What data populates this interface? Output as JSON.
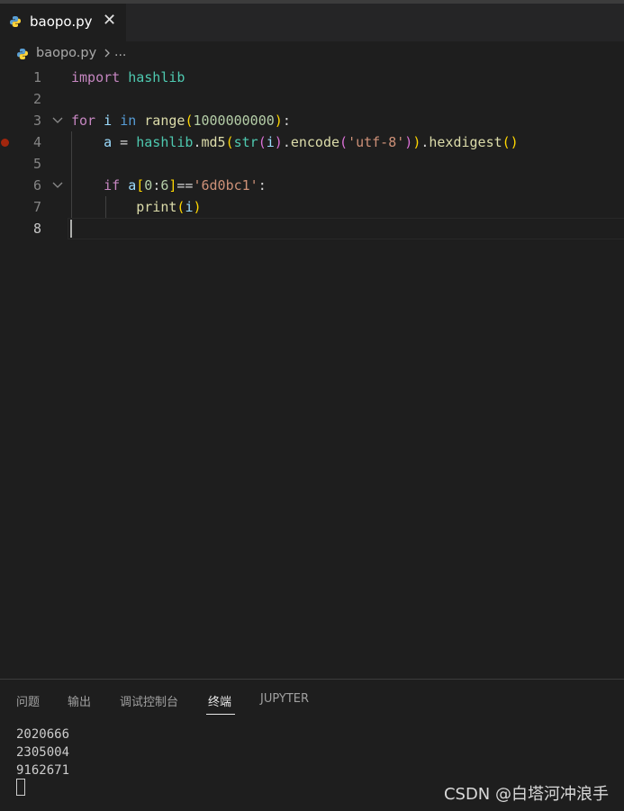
{
  "tab": {
    "filename": "baopo.py",
    "close_glyph": "✕",
    "icon": "python-icon"
  },
  "breadcrumb": {
    "file": "baopo.py",
    "more": "..."
  },
  "editor": {
    "line_numbers": [
      "1",
      "2",
      "3",
      "4",
      "5",
      "6",
      "7",
      "8"
    ],
    "breakpoint_line": 4,
    "current_line": 8
  },
  "panel": {
    "tabs": [
      "问题",
      "输出",
      "调试控制台",
      "终端",
      "JUPYTER"
    ],
    "active_tab": "终端",
    "terminal_lines": [
      "2020666",
      "2305004",
      "9162671"
    ]
  },
  "watermark": "CSDN @白塔河冲浪手",
  "colors": {
    "keyword_ctrl": "#c586c0",
    "keyword": "#569cd6",
    "function": "#dcdcaa",
    "string": "#ce9178",
    "number": "#b5cea8",
    "variable": "#9cdcfe",
    "module": "#4ec9b0"
  }
}
